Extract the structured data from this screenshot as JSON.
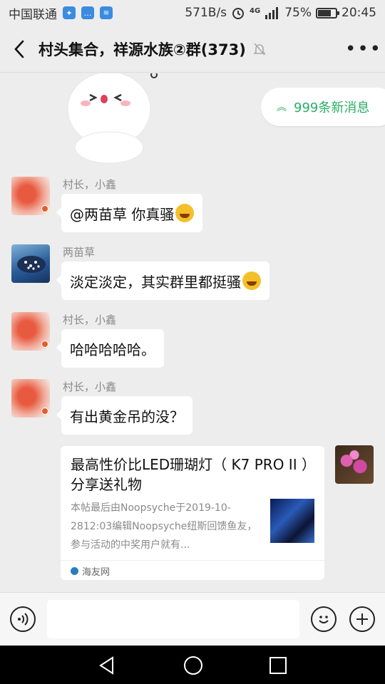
{
  "status_bar": {
    "carrier": "中国联通",
    "speed": "571B/s",
    "network": "4G",
    "battery": "75%",
    "battery_level": 0.75,
    "time": "20:45"
  },
  "header": {
    "title": "村头集合，祥源水族②群(373)"
  },
  "new_messages": {
    "label": "999条新消息"
  },
  "messages": [
    {
      "sender": "村长，小鑫",
      "text": "@两苗草  你真骚",
      "emoji": "crying-laughing"
    },
    {
      "sender": "两苗草",
      "text": "淡定淡定，其实群里都挺骚",
      "emoji": "laughing-tears"
    },
    {
      "sender": "村长，小鑫",
      "text": "哈哈哈哈哈。"
    },
    {
      "sender": "村长，小鑫",
      "text": "有出黄金吊的没？"
    }
  ],
  "link_card": {
    "title": "最高性价比LED珊瑚灯（ K7 PRO II ）分享送礼物",
    "description": "本帖最后由Noopsyche于2019-10-2812:03编辑Noopsyche纽斯回馈鱼友，参与活动的中奖用户就有...",
    "source": "海友网"
  },
  "colors": {
    "accent_green": "#2aae67",
    "background": "#ededed",
    "bubble": "#ffffff"
  }
}
